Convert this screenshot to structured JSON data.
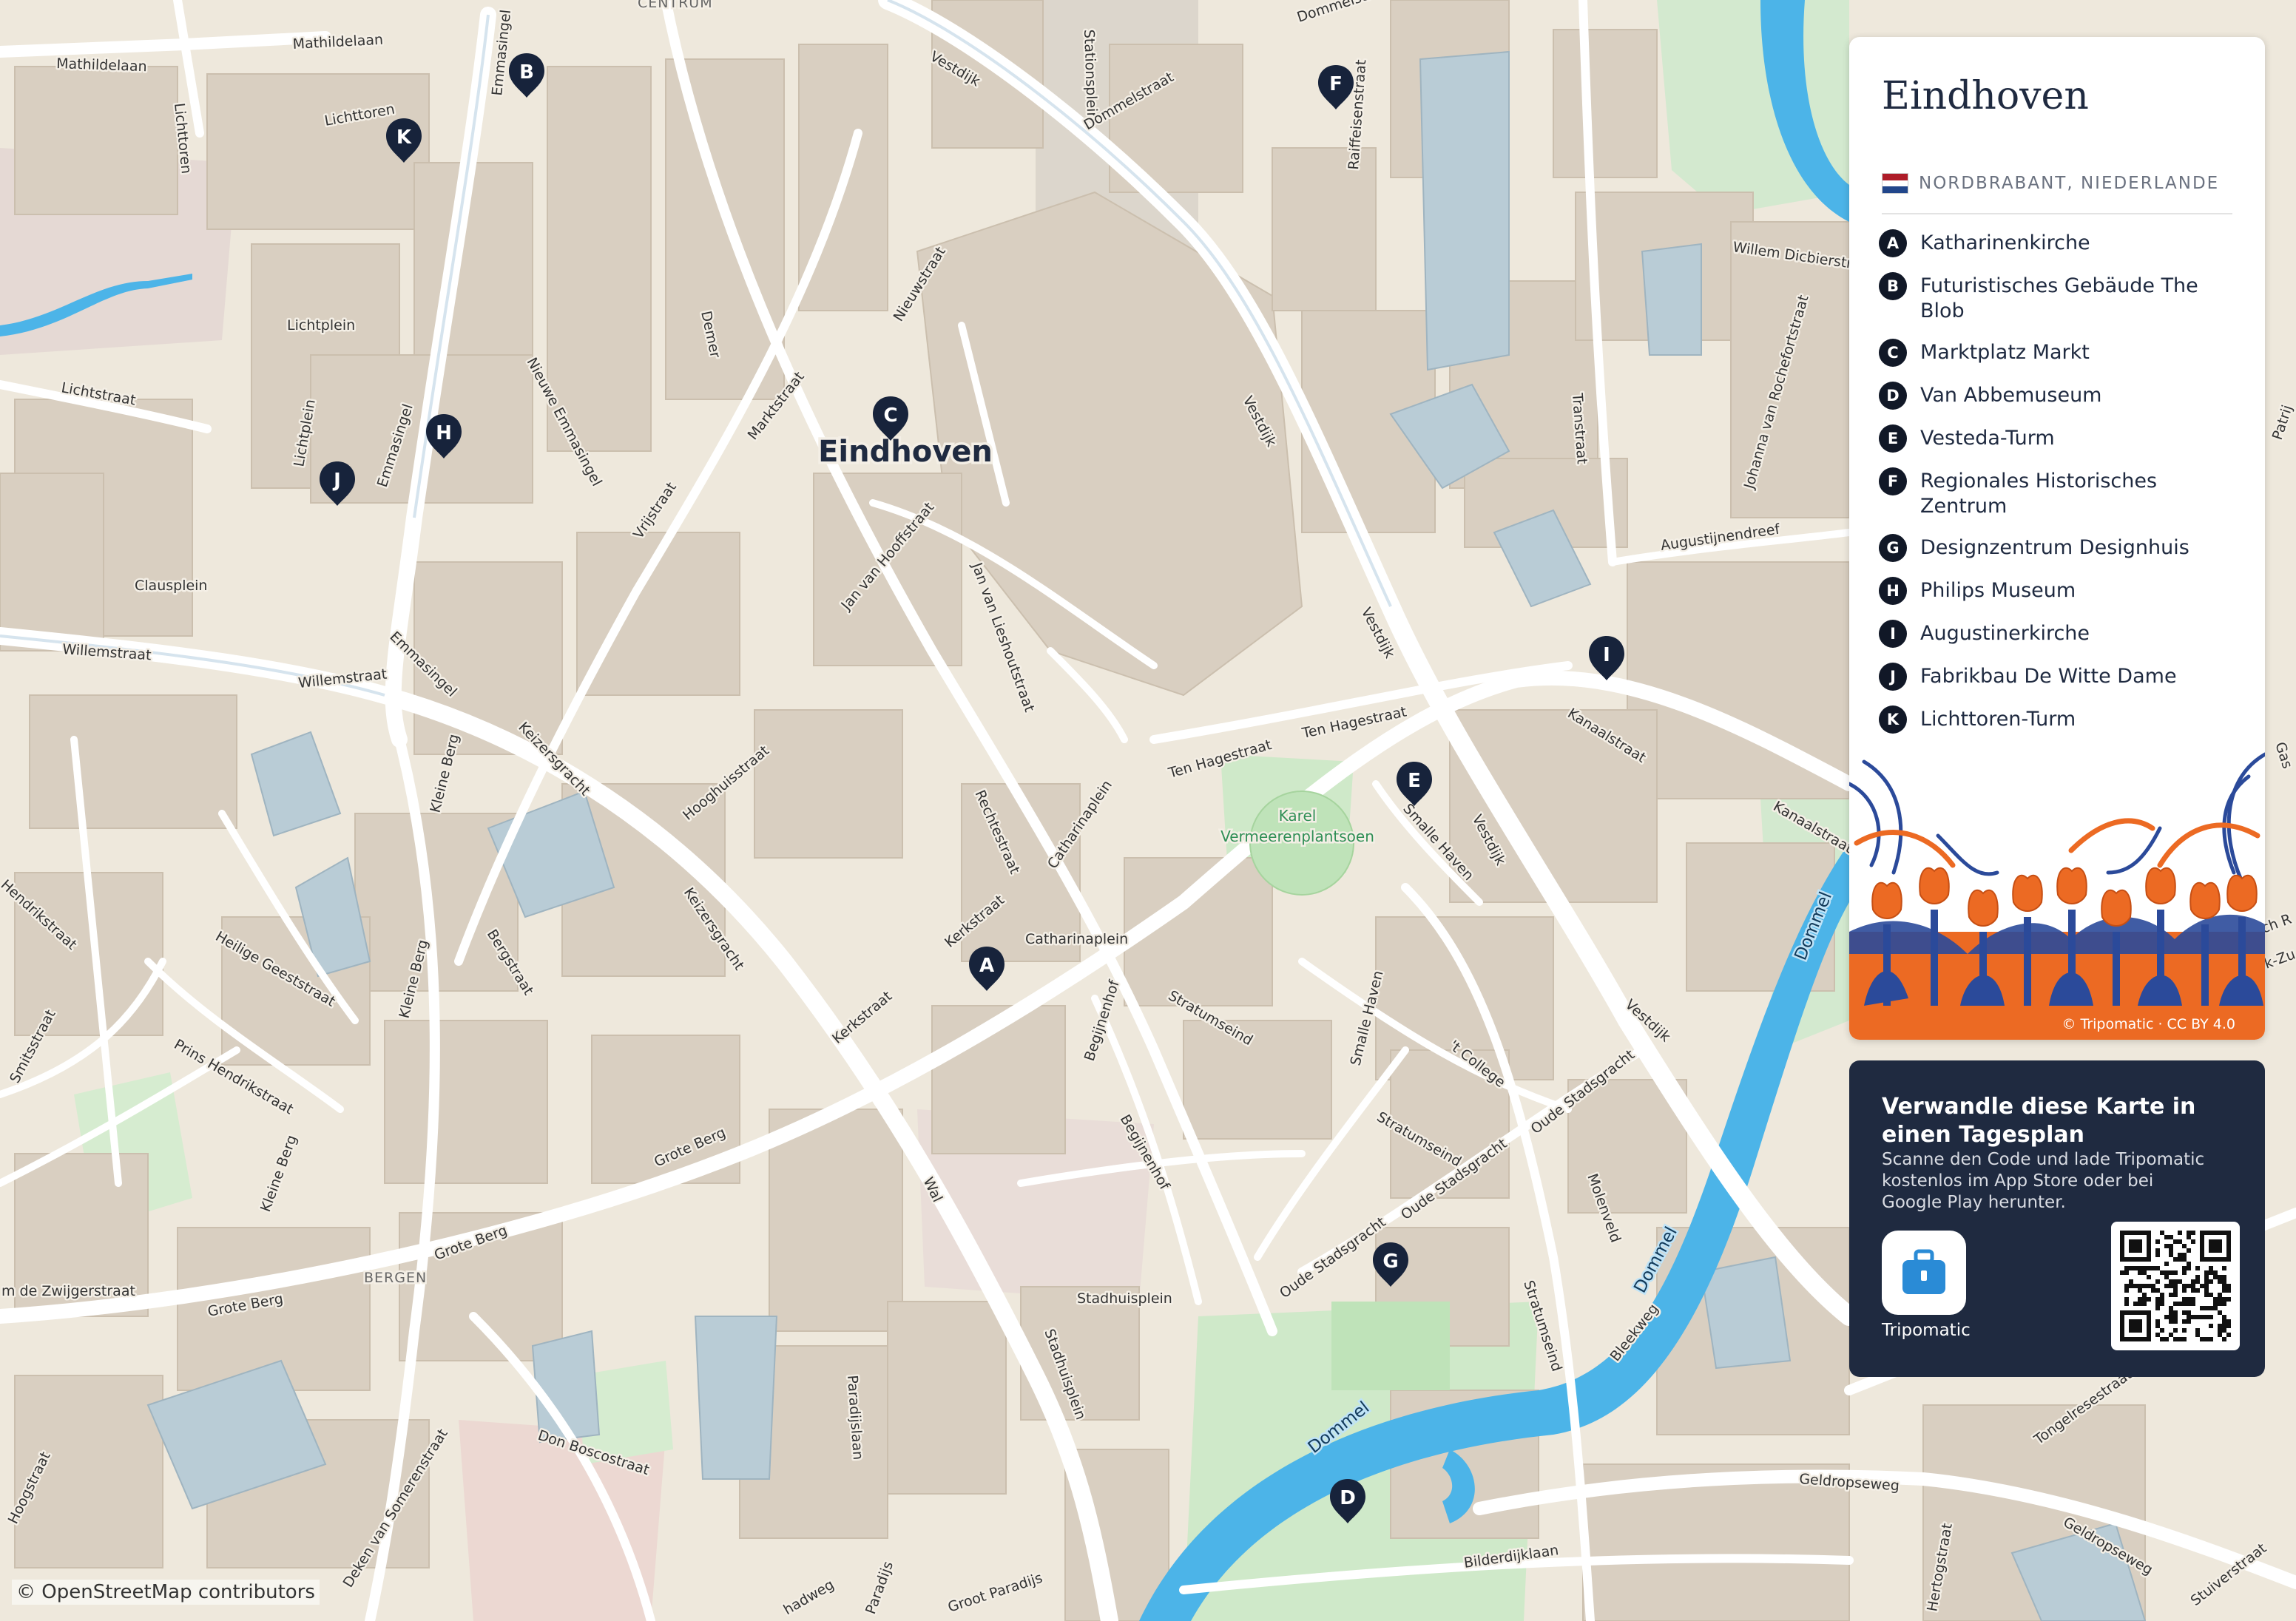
{
  "map": {
    "city_label": "Eindhoven",
    "district_labels": [
      "CENTRUM",
      "BERGEN"
    ],
    "street_labels": [
      "Mathildelaan",
      "Mathildelaan",
      "Lichttoren",
      "Lichttoren",
      "Emmasingel",
      "Stationsplein",
      "Dommelstraat",
      "Dommelstraat",
      "Raiffeisenstraat",
      "Vestdijk",
      "Vestdijk",
      "Vestdijk",
      "Vestdijk",
      "Vestdijk",
      "Nieuwstraat",
      "Demer",
      "Marktstraat",
      "Lichtplein",
      "Lichtstraat",
      "Lichtplein",
      "Emmasingel",
      "Nieuwe Emmasingel",
      "Vrijstraat",
      "Jan van Hooffstraat",
      "Jan van Lieshoutstraat",
      "Clausplein",
      "Willemstraat",
      "Willemstraat",
      "Emmasingel",
      "Keizersgracht",
      "Keizersgracht",
      "Hooghuisstraat",
      "Rechtestraat",
      "Catharinaplein",
      "Ten Hagestraat",
      "Ten Hagestraat",
      "Kerkstraat",
      "Catharinaplein",
      "Kerkstraat",
      "Smalle Haven",
      "Smalle Haven",
      "Stratumseind",
      "Stratumseind",
      "Begijnenhof",
      "Begijnenhof",
      "'t College",
      "Oude Stadsgracht",
      "Oude Stadsgracht",
      "Oude Stadsgracht",
      "Molenveld",
      "Stratumseind",
      "Bleekweg",
      "Wal",
      "Stadhuisplein",
      "Stadhuisplein",
      "Paradijslaan",
      "Grote Berg",
      "Grote Berg",
      "Grote Berg",
      "Kleine Berg",
      "Kleine Berg",
      "Kleine Berg",
      "Bergstraat",
      "Heilige Geeststraat",
      "Prins Hendrikstraat",
      "Hendrikstraat",
      "Smitsstraat",
      "m de Zwijgerstraat",
      "Don Boscostraat",
      "Deken van Somerenstraat",
      "Hoogstraat",
      "Groot Paradijs",
      "hadweg",
      "Paradijs",
      "Kanaalstraat",
      "Kanaalstraat",
      "Transtraat",
      "Augustijnendreef",
      "Johanna van Rochefortstraat",
      "Willem Dicbierstr",
      "Tongelresestraat",
      "Geldropseweg",
      "Geldropseweg",
      "Bilderdijklaan",
      "Hertogstraat",
      "Stuiverstraat",
      "Patrij",
      "Gas",
      "k-Zu",
      "ch R"
    ],
    "water_labels": [
      "Dommel",
      "Dommel",
      "Dommel"
    ],
    "park_labels": [
      "Karel",
      "Vermeerenplantsoen"
    ],
    "pins": [
      "A",
      "B",
      "C",
      "D",
      "E",
      "F",
      "G",
      "H",
      "I",
      "J",
      "K"
    ],
    "attribution": "© OpenStreetMap contributors"
  },
  "legend": {
    "title": "Eindhoven",
    "region": "NORDBRABANT, NIEDERLANDE",
    "items": [
      {
        "letter": "A",
        "name": "Katharinenkirche"
      },
      {
        "letter": "B",
        "name": "Futuristisches Gebäude The Blob"
      },
      {
        "letter": "C",
        "name": "Marktplatz Markt"
      },
      {
        "letter": "D",
        "name": "Van Abbemuseum"
      },
      {
        "letter": "E",
        "name": "Vesteda-Turm"
      },
      {
        "letter": "F",
        "name": "Regionales Historisches Zentrum"
      },
      {
        "letter": "G",
        "name": "Designzentrum Designhuis"
      },
      {
        "letter": "H",
        "name": "Philips Museum"
      },
      {
        "letter": "I",
        "name": "Augustinerkirche"
      },
      {
        "letter": "J",
        "name": "Fabrikbau De Witte Dame"
      },
      {
        "letter": "K",
        "name": "Lichttoren-Turm"
      }
    ],
    "art_attribution": "© Tripomatic · CC BY 4.0"
  },
  "cta": {
    "title": "Verwandle diese Karte in einen Tagesplan",
    "text": "Scanne den Code und lade Tripomatic kostenlos im App Store oder bei Google Play herunter.",
    "app_name": "Tripomatic"
  },
  "colors": {
    "land": "#eee8dc",
    "building": "#d9cfc1",
    "road": "#ffffff",
    "water": "#4cb4e8",
    "park": "#cfe9c9",
    "pin": "#17233b",
    "card_dark": "#1f2a40",
    "accent_orange": "#ec6a23",
    "delft_blue": "#2b4a9a"
  }
}
